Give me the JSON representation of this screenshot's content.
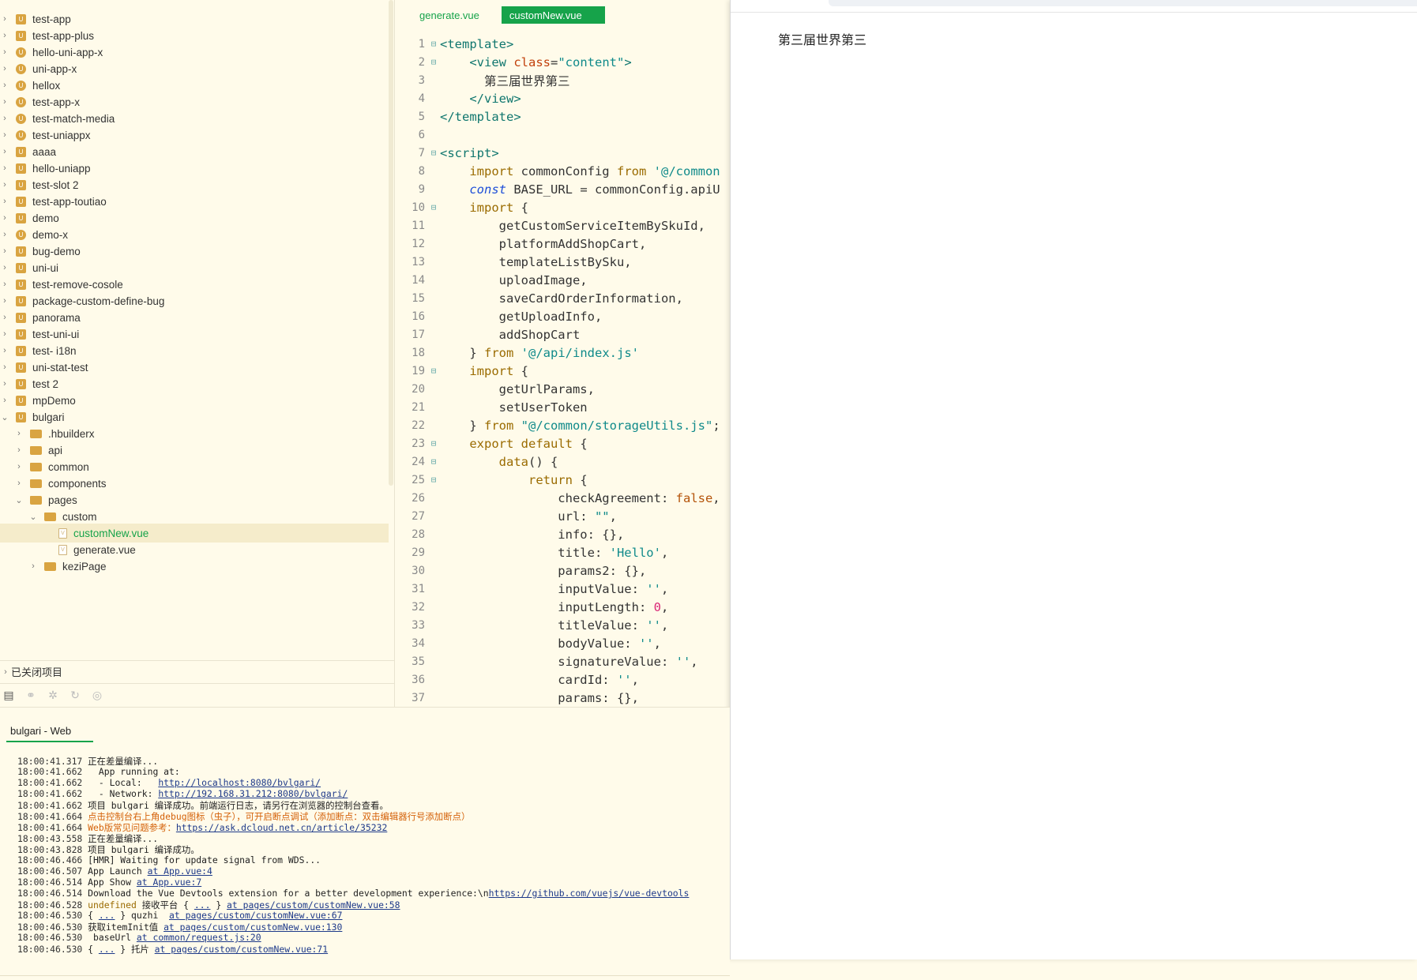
{
  "explorer": {
    "items": [
      {
        "label": "test-app",
        "icon": "proj",
        "level": 0,
        "expanded": false
      },
      {
        "label": "test-app-plus",
        "icon": "proj",
        "level": 0,
        "expanded": false
      },
      {
        "label": "hello-uni-app-x",
        "icon": "uni",
        "level": 0,
        "expanded": false
      },
      {
        "label": "uni-app-x",
        "icon": "uni",
        "level": 0,
        "expanded": false
      },
      {
        "label": "hellox",
        "icon": "uni",
        "level": 0,
        "expanded": false
      },
      {
        "label": "test-app-x",
        "icon": "uni",
        "level": 0,
        "expanded": false
      },
      {
        "label": "test-match-media",
        "icon": "uni",
        "level": 0,
        "expanded": false
      },
      {
        "label": "test-uniappx",
        "icon": "uni",
        "level": 0,
        "expanded": false
      },
      {
        "label": "aaaa",
        "icon": "proj",
        "level": 0,
        "expanded": false
      },
      {
        "label": "hello-uniapp",
        "icon": "proj",
        "level": 0,
        "expanded": false
      },
      {
        "label": "test-slot 2",
        "icon": "proj",
        "level": 0,
        "expanded": false
      },
      {
        "label": "test-app-toutiao",
        "icon": "proj",
        "level": 0,
        "expanded": false
      },
      {
        "label": "demo",
        "icon": "proj",
        "level": 0,
        "expanded": false
      },
      {
        "label": "demo-x",
        "icon": "uni",
        "level": 0,
        "expanded": false
      },
      {
        "label": "bug-demo",
        "icon": "proj",
        "level": 0,
        "expanded": false
      },
      {
        "label": "uni-ui",
        "icon": "proj",
        "level": 0,
        "expanded": false
      },
      {
        "label": "test-remove-cosole",
        "icon": "proj",
        "level": 0,
        "expanded": false
      },
      {
        "label": "package-custom-define-bug",
        "icon": "proj",
        "level": 0,
        "expanded": false
      },
      {
        "label": "panorama",
        "icon": "proj",
        "level": 0,
        "expanded": false
      },
      {
        "label": "test-uni-ui",
        "icon": "proj",
        "level": 0,
        "expanded": false
      },
      {
        "label": "test- i18n",
        "icon": "proj",
        "level": 0,
        "expanded": false
      },
      {
        "label": "uni-stat-test",
        "icon": "proj",
        "level": 0,
        "expanded": false
      },
      {
        "label": "test 2",
        "icon": "proj",
        "level": 0,
        "expanded": false
      },
      {
        "label": "mpDemo",
        "icon": "proj",
        "level": 0,
        "expanded": false
      },
      {
        "label": "bulgari",
        "icon": "proj",
        "level": 0,
        "expanded": true
      },
      {
        "label": ".hbuilderx",
        "icon": "folder",
        "level": 1,
        "expanded": false
      },
      {
        "label": "api",
        "icon": "folder",
        "level": 1,
        "expanded": false
      },
      {
        "label": "common",
        "icon": "folder",
        "level": 1,
        "expanded": false
      },
      {
        "label": "components",
        "icon": "folder",
        "level": 1,
        "expanded": false
      },
      {
        "label": "pages",
        "icon": "folder",
        "level": 1,
        "expanded": true
      },
      {
        "label": "custom",
        "icon": "folder",
        "level": 2,
        "expanded": true
      },
      {
        "label": "customNew.vue",
        "icon": "file",
        "level": 3,
        "selected": true
      },
      {
        "label": "generate.vue",
        "icon": "file",
        "level": 3
      },
      {
        "label": "keziPage",
        "icon": "folder",
        "level": 2,
        "expanded": false
      }
    ],
    "closed_projects": "已关闭项目"
  },
  "editor": {
    "tabs": [
      {
        "label": "generate.vue",
        "active": false
      },
      {
        "label": "customNew.vue",
        "active": true
      }
    ],
    "lines": [
      {
        "n": "1",
        "fold": true,
        "segs": [
          [
            "tag",
            "<template>"
          ]
        ]
      },
      {
        "n": "2",
        "fold": true,
        "segs": [
          [
            "txt",
            "    "
          ],
          [
            "tag",
            "<view "
          ],
          [
            "attr",
            "class"
          ],
          [
            "txt",
            "="
          ],
          [
            "str",
            "\"content\""
          ],
          [
            "tag",
            ">"
          ]
        ]
      },
      {
        "n": "3",
        "fold": false,
        "segs": [
          [
            "txt",
            "      第三届世界第三"
          ]
        ]
      },
      {
        "n": "4",
        "fold": false,
        "segs": [
          [
            "txt",
            "    "
          ],
          [
            "tag",
            "</view>"
          ]
        ]
      },
      {
        "n": "5",
        "fold": false,
        "segs": [
          [
            "tag",
            "</template>"
          ]
        ]
      },
      {
        "n": "6",
        "fold": false,
        "segs": []
      },
      {
        "n": "7",
        "fold": true,
        "segs": [
          [
            "tag",
            "<script>"
          ]
        ]
      },
      {
        "n": "8",
        "fold": false,
        "segs": [
          [
            "txt",
            "    "
          ],
          [
            "kw",
            "import"
          ],
          [
            "txt",
            " commonConfig "
          ],
          [
            "kw",
            "from"
          ],
          [
            "txt",
            " "
          ],
          [
            "str",
            "'@/common"
          ]
        ]
      },
      {
        "n": "9",
        "fold": false,
        "segs": [
          [
            "txt",
            "    "
          ],
          [
            "kwi",
            "const"
          ],
          [
            "txt",
            " BASE_URL = commonConfig.apiU"
          ]
        ]
      },
      {
        "n": "10",
        "fold": true,
        "segs": [
          [
            "txt",
            "    "
          ],
          [
            "kw",
            "import"
          ],
          [
            "txt",
            " {"
          ]
        ]
      },
      {
        "n": "11",
        "fold": false,
        "segs": [
          [
            "txt",
            "        getCustomServiceItemBySkuId,"
          ]
        ]
      },
      {
        "n": "12",
        "fold": false,
        "segs": [
          [
            "txt",
            "        platformAddShopCart,"
          ]
        ]
      },
      {
        "n": "13",
        "fold": false,
        "segs": [
          [
            "txt",
            "        templateListBySku,"
          ]
        ]
      },
      {
        "n": "14",
        "fold": false,
        "segs": [
          [
            "txt",
            "        uploadImage,"
          ]
        ]
      },
      {
        "n": "15",
        "fold": false,
        "segs": [
          [
            "txt",
            "        saveCardOrderInformation,"
          ]
        ]
      },
      {
        "n": "16",
        "fold": false,
        "segs": [
          [
            "txt",
            "        getUploadInfo,"
          ]
        ]
      },
      {
        "n": "17",
        "fold": false,
        "segs": [
          [
            "txt",
            "        addShopCart"
          ]
        ]
      },
      {
        "n": "18",
        "fold": false,
        "segs": [
          [
            "txt",
            "    } "
          ],
          [
            "kw",
            "from"
          ],
          [
            "txt",
            " "
          ],
          [
            "str",
            "'@/api/index.js'"
          ]
        ]
      },
      {
        "n": "19",
        "fold": true,
        "segs": [
          [
            "txt",
            "    "
          ],
          [
            "kw",
            "import"
          ],
          [
            "txt",
            " {"
          ]
        ]
      },
      {
        "n": "20",
        "fold": false,
        "segs": [
          [
            "txt",
            "        getUrlParams,"
          ]
        ]
      },
      {
        "n": "21",
        "fold": false,
        "segs": [
          [
            "txt",
            "        setUserToken"
          ]
        ]
      },
      {
        "n": "22",
        "fold": false,
        "segs": [
          [
            "txt",
            "    } "
          ],
          [
            "kw",
            "from"
          ],
          [
            "txt",
            " "
          ],
          [
            "str",
            "\"@/common/storageUtils.js\""
          ],
          [
            "txt",
            ";"
          ]
        ]
      },
      {
        "n": "23",
        "fold": true,
        "segs": [
          [
            "txt",
            "    "
          ],
          [
            "kw",
            "export default"
          ],
          [
            "txt",
            " {"
          ]
        ]
      },
      {
        "n": "24",
        "fold": true,
        "segs": [
          [
            "txt",
            "        "
          ],
          [
            "kw",
            "data"
          ],
          [
            "txt",
            "() {"
          ]
        ]
      },
      {
        "n": "25",
        "fold": true,
        "segs": [
          [
            "txt",
            "            "
          ],
          [
            "kw",
            "return"
          ],
          [
            "txt",
            " {"
          ]
        ]
      },
      {
        "n": "26",
        "fold": false,
        "segs": [
          [
            "txt",
            "                checkAgreement: "
          ],
          [
            "bool",
            "false"
          ],
          [
            "txt",
            ","
          ]
        ]
      },
      {
        "n": "27",
        "fold": false,
        "segs": [
          [
            "txt",
            "                url: "
          ],
          [
            "str",
            "\"\""
          ],
          [
            "txt",
            ","
          ]
        ]
      },
      {
        "n": "28",
        "fold": false,
        "segs": [
          [
            "txt",
            "                info: {},"
          ]
        ]
      },
      {
        "n": "29",
        "fold": false,
        "segs": [
          [
            "txt",
            "                title: "
          ],
          [
            "str",
            "'Hello'"
          ],
          [
            "txt",
            ","
          ]
        ]
      },
      {
        "n": "30",
        "fold": false,
        "segs": [
          [
            "txt",
            "                params2: {},"
          ]
        ]
      },
      {
        "n": "31",
        "fold": false,
        "segs": [
          [
            "txt",
            "                inputValue: "
          ],
          [
            "str",
            "''"
          ],
          [
            "txt",
            ","
          ]
        ]
      },
      {
        "n": "32",
        "fold": false,
        "segs": [
          [
            "txt",
            "                inputLength: "
          ],
          [
            "num",
            "0"
          ],
          [
            "txt",
            ","
          ]
        ]
      },
      {
        "n": "33",
        "fold": false,
        "segs": [
          [
            "txt",
            "                titleValue: "
          ],
          [
            "str",
            "''"
          ],
          [
            "txt",
            ","
          ]
        ]
      },
      {
        "n": "34",
        "fold": false,
        "segs": [
          [
            "txt",
            "                bodyValue: "
          ],
          [
            "str",
            "''"
          ],
          [
            "txt",
            ","
          ]
        ]
      },
      {
        "n": "35",
        "fold": false,
        "segs": [
          [
            "txt",
            "                signatureValue: "
          ],
          [
            "str",
            "''"
          ],
          [
            "txt",
            ","
          ]
        ]
      },
      {
        "n": "36",
        "fold": false,
        "segs": [
          [
            "txt",
            "                cardId: "
          ],
          [
            "str",
            "''"
          ],
          [
            "txt",
            ","
          ]
        ]
      },
      {
        "n": "37",
        "fold": false,
        "segs": [
          [
            "txt",
            "                params: {},"
          ]
        ]
      }
    ]
  },
  "preview": {
    "text": "第三届世界第三"
  },
  "console": {
    "tab_label": "bulgari - Web",
    "lines": [
      {
        "time": "18:00:41.317",
        "type": "normal",
        "segs": [
          [
            "txt",
            "正在差量编译..."
          ]
        ]
      },
      {
        "time": "18:00:41.662",
        "type": "normal",
        "segs": [
          [
            "txt",
            "  App running at:"
          ]
        ]
      },
      {
        "time": "18:00:41.662",
        "type": "normal",
        "segs": [
          [
            "txt",
            "  - Local:   "
          ],
          [
            "link",
            "http://localhost:8080/bvlgari/"
          ]
        ]
      },
      {
        "time": "18:00:41.662",
        "type": "normal",
        "segs": [
          [
            "txt",
            "  - Network: "
          ],
          [
            "link",
            "http://192.168.31.212:8080/bvlgari/"
          ]
        ]
      },
      {
        "time": "18:00:41.662",
        "type": "normal",
        "segs": [
          [
            "txt",
            "项目 bulgari 编译成功。前端运行日志，请另行在浏览器的控制台查看。"
          ]
        ]
      },
      {
        "time": "18:00:41.664",
        "type": "warn",
        "segs": [
          [
            "txt",
            "点击控制台右上角debug图标（虫子），可开启断点调试（添加断点：双击编辑器行号添加断点）"
          ]
        ]
      },
      {
        "time": "18:00:41.664",
        "type": "warn",
        "segs": [
          [
            "txt",
            "Web版常见问题参考："
          ],
          [
            "link",
            "https://ask.dcloud.net.cn/article/35232"
          ]
        ]
      },
      {
        "time": "18:00:43.558",
        "type": "normal",
        "segs": [
          [
            "txt",
            "正在差量编译..."
          ]
        ]
      },
      {
        "time": "18:00:43.828",
        "type": "normal",
        "segs": [
          [
            "txt",
            "项目 bulgari 编译成功。"
          ]
        ]
      },
      {
        "time": "18:00:46.466",
        "type": "normal",
        "segs": [
          [
            "txt",
            "[HMR] Waiting for update signal from WDS..."
          ]
        ]
      },
      {
        "time": "18:00:46.507",
        "type": "normal",
        "segs": [
          [
            "txt",
            "App Launch "
          ],
          [
            "link",
            "at App.vue:4"
          ]
        ]
      },
      {
        "time": "18:00:46.514",
        "type": "normal",
        "segs": [
          [
            "txt",
            "App Show "
          ],
          [
            "link",
            "at App.vue:7"
          ]
        ]
      },
      {
        "time": "18:00:46.514",
        "type": "normal",
        "segs": [
          [
            "txt",
            "Download the Vue Devtools extension for a better development experience:\\n"
          ],
          [
            "link",
            "https://github.com/vuejs/vue-devtools"
          ]
        ]
      },
      {
        "time": "18:00:46.528",
        "type": "normal",
        "segs": [
          [
            "undef",
            "undefined"
          ],
          [
            "txt",
            " 接收平台 { "
          ],
          [
            "link",
            "..."
          ],
          [
            "txt",
            " } "
          ],
          [
            "link",
            "at pages/custom/customNew.vue:58"
          ]
        ]
      },
      {
        "time": "18:00:46.530",
        "type": "normal",
        "segs": [
          [
            "txt",
            "{ "
          ],
          [
            "link",
            "..."
          ],
          [
            "txt",
            " } quzhi  "
          ],
          [
            "link",
            "at pages/custom/customNew.vue:67"
          ]
        ]
      },
      {
        "time": "18:00:46.530",
        "type": "normal",
        "segs": [
          [
            "txt",
            "获取itemInit值 "
          ],
          [
            "link",
            "at pages/custom/customNew.vue:130"
          ]
        ]
      },
      {
        "time": "18:00:46.530",
        "type": "normal",
        "segs": [
          [
            "txt",
            " baseUrl "
          ],
          [
            "link",
            "at common/request.js:20"
          ]
        ]
      },
      {
        "time": "18:00:46.530",
        "type": "normal",
        "segs": [
          [
            "txt",
            "{ "
          ],
          [
            "link",
            "..."
          ],
          [
            "txt",
            " } 托片 "
          ],
          [
            "link",
            "at pages/custom/customNew.vue:71"
          ]
        ]
      }
    ]
  }
}
